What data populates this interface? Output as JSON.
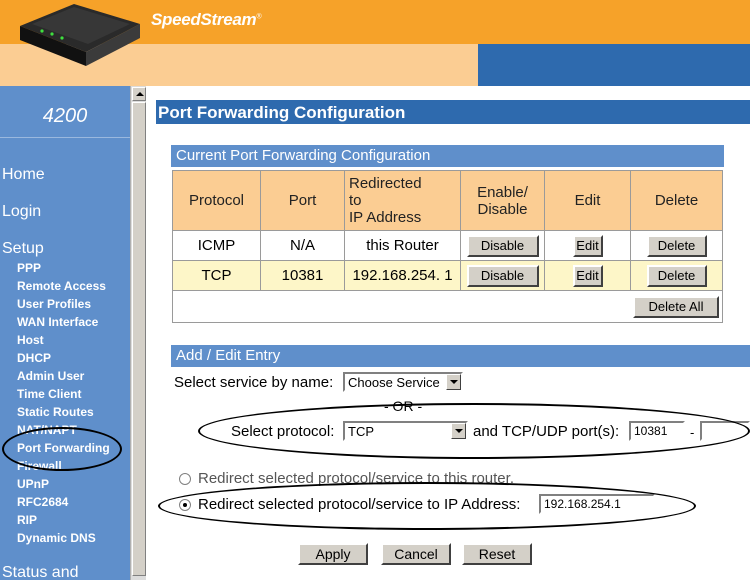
{
  "header": {
    "brand": "SpeedStream",
    "trademark": "®"
  },
  "sidebar": {
    "model": "4200",
    "top_items": [
      "Home",
      "Login",
      "Setup",
      "Status and"
    ],
    "setup_items": [
      "PPP",
      "Remote Access",
      "User Profiles",
      "WAN Interface",
      "Host",
      "DHCP",
      "Admin User",
      "Time Client",
      "Static Routes",
      "NAT/NAPT",
      "Port Forwarding",
      "Firewall",
      "UPnP",
      "RFC2684",
      "RIP",
      "Dynamic DNS"
    ]
  },
  "main": {
    "page_title": "Port Forwarding Configuration",
    "current_section": "Current Port Forwarding Configuration",
    "table": {
      "headers": [
        "Protocol",
        "Port",
        "Redirected\nto\nIP Address",
        "Enable/\nDisable",
        "Edit",
        "Delete"
      ],
      "rows": [
        {
          "protocol": "ICMP",
          "port": "N/A",
          "redirect": "this Router",
          "toggle": "Disable",
          "edit": "Edit",
          "delete": "Delete"
        },
        {
          "protocol": "TCP",
          "port": "10381",
          "redirect": "192.168.254. 1",
          "toggle": "Disable",
          "edit": "Edit",
          "delete": "Delete"
        }
      ],
      "delete_all": "Delete All"
    },
    "add_section": "Add / Edit Entry",
    "form": {
      "service_label": "Select service by name:",
      "service_value": "Choose Service",
      "or_label": "- OR -",
      "protocol_label": "Select protocol:",
      "protocol_value": "TCP",
      "ports_label": "and TCP/UDP port(s):",
      "port_start": "10381",
      "port_dash": "-",
      "radio_router": "Redirect selected protocol/service to this router.",
      "radio_ip": "Redirect selected protocol/service to IP Address:",
      "ip_value": "192.168.254.1",
      "apply": "Apply",
      "cancel": "Cancel",
      "reset": "Reset"
    }
  },
  "colors": {
    "orange": "#f6a229",
    "peach": "#fbcd93",
    "blue_dark": "#2e6aae",
    "blue_mid": "#5f8fcb",
    "row_highlight": "#fdf6c8"
  }
}
